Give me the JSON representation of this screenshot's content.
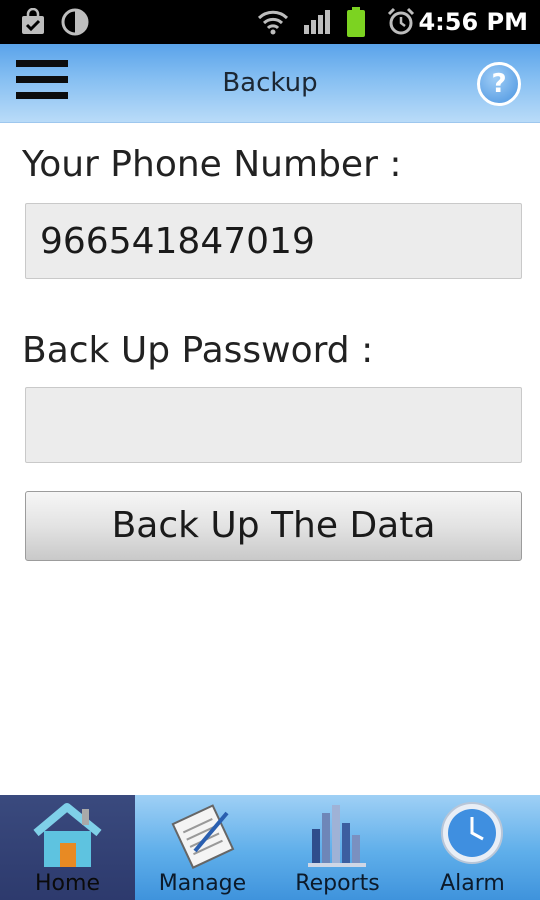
{
  "status_bar": {
    "time": "4:56 PM",
    "icons": [
      "shopping-bag-icon",
      "brightness-icon",
      "wifi-icon",
      "signal-icon",
      "battery-icon",
      "alarm-clock-icon"
    ]
  },
  "header": {
    "title": "Backup",
    "menu_icon": "hamburger-menu-icon",
    "help_icon": "help-icon",
    "help_glyph": "?"
  },
  "form": {
    "phone_label": "Your Phone Number :",
    "phone_value": "966541847019",
    "password_label": "Back Up Password :",
    "password_value": "",
    "backup_button_label": "Back Up The Data"
  },
  "tabs": [
    {
      "label": "Home",
      "icon": "home-icon",
      "active": true
    },
    {
      "label": "Manage",
      "icon": "notepad-icon",
      "active": false
    },
    {
      "label": "Reports",
      "icon": "bar-chart-icon",
      "active": false
    },
    {
      "label": "Alarm",
      "icon": "clock-icon",
      "active": false
    }
  ],
  "colors": {
    "header_gradient_top": "#5aa3ea",
    "tabbar_blue": "#5eaeea",
    "active_tab": "#2d3a6d"
  }
}
